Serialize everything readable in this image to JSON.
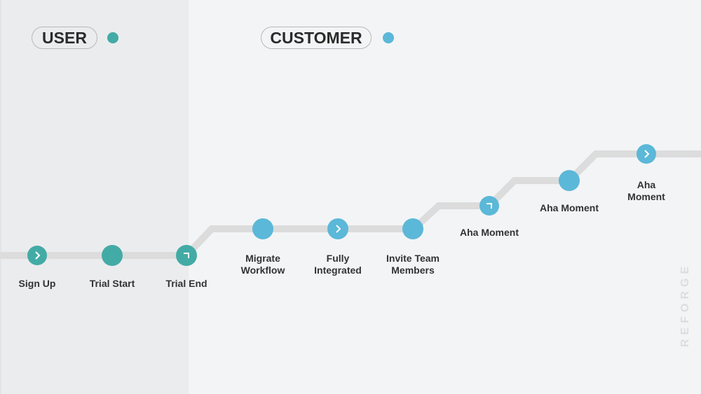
{
  "legend": {
    "user": {
      "label": "USER",
      "color": "#43aba5"
    },
    "customer": {
      "label": "CUSTOMER",
      "color": "#5bb8d8"
    }
  },
  "colors": {
    "track": "#dcdcdc",
    "user_stage": "#43aba5",
    "customer_stage": "#5bb8d8"
  },
  "nodes": [
    {
      "label": "Sign Up",
      "stage": "user",
      "icon": "chevron-right"
    },
    {
      "label": "Trial Start",
      "stage": "user",
      "icon": "none"
    },
    {
      "label": "Trial End",
      "stage": "user",
      "icon": "corner"
    },
    {
      "label": "Migrate\nWorkflow",
      "stage": "customer",
      "icon": "none"
    },
    {
      "label": "Fully\nIntegrated",
      "stage": "customer",
      "icon": "chevron-right"
    },
    {
      "label": "Invite Team\nMembers",
      "stage": "customer",
      "icon": "none"
    },
    {
      "label": "Aha Moment",
      "stage": "customer",
      "icon": "corner"
    },
    {
      "label": "Aha Moment",
      "stage": "customer",
      "icon": "none"
    },
    {
      "label": "Aha Moment",
      "stage": "customer",
      "icon": "chevron-right"
    }
  ],
  "brand": "REFORGE"
}
